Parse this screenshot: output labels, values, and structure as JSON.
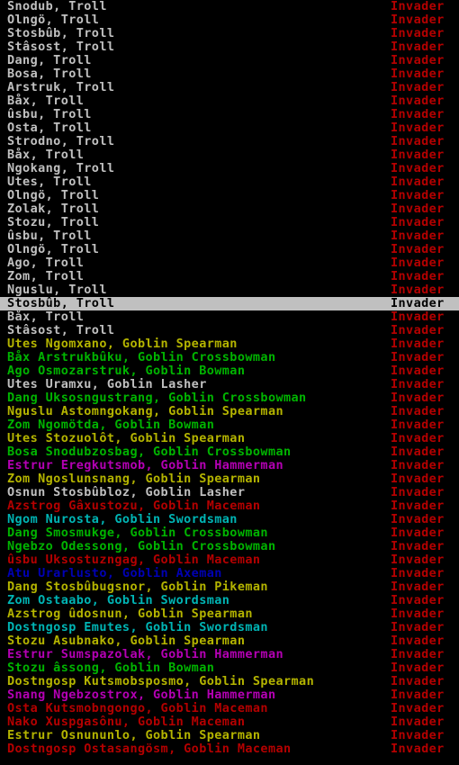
{
  "status_color": "#b40000",
  "selected_index": 22,
  "units": [
    {
      "name": "Snodub, Troll",
      "status": "Invader",
      "color": "#c0c0c0"
    },
    {
      "name": "Olngö, Troll",
      "status": "Invader",
      "color": "#c0c0c0"
    },
    {
      "name": "Stosbûb, Troll",
      "status": "Invader",
      "color": "#c0c0c0"
    },
    {
      "name": "Stâsost, Troll",
      "status": "Invader",
      "color": "#c0c0c0"
    },
    {
      "name": "Dang, Troll",
      "status": "Invader",
      "color": "#c0c0c0"
    },
    {
      "name": "Bosa, Troll",
      "status": "Invader",
      "color": "#c0c0c0"
    },
    {
      "name": "Arstruk, Troll",
      "status": "Invader",
      "color": "#c0c0c0"
    },
    {
      "name": "Båx, Troll",
      "status": "Invader",
      "color": "#c0c0c0"
    },
    {
      "name": "ûsbu, Troll",
      "status": "Invader",
      "color": "#c0c0c0"
    },
    {
      "name": "Osta, Troll",
      "status": "Invader",
      "color": "#c0c0c0"
    },
    {
      "name": "Strodno, Troll",
      "status": "Invader",
      "color": "#c0c0c0"
    },
    {
      "name": "Båx, Troll",
      "status": "Invader",
      "color": "#c0c0c0"
    },
    {
      "name": "Ngokang, Troll",
      "status": "Invader",
      "color": "#c0c0c0"
    },
    {
      "name": "Utes, Troll",
      "status": "Invader",
      "color": "#c0c0c0"
    },
    {
      "name": "Olngö, Troll",
      "status": "Invader",
      "color": "#c0c0c0"
    },
    {
      "name": "Zolak, Troll",
      "status": "Invader",
      "color": "#c0c0c0"
    },
    {
      "name": "Stozu, Troll",
      "status": "Invader",
      "color": "#c0c0c0"
    },
    {
      "name": "ûsbu, Troll",
      "status": "Invader",
      "color": "#c0c0c0"
    },
    {
      "name": "Olngö, Troll",
      "status": "Invader",
      "color": "#c0c0c0"
    },
    {
      "name": "Ago, Troll",
      "status": "Invader",
      "color": "#c0c0c0"
    },
    {
      "name": "Zom, Troll",
      "status": "Invader",
      "color": "#c0c0c0"
    },
    {
      "name": "Nguslu, Troll",
      "status": "Invader",
      "color": "#c0c0c0"
    },
    {
      "name": "Stosbûb, Troll",
      "status": "Invader",
      "color": "#c0c0c0"
    },
    {
      "name": "Båx, Troll",
      "status": "Invader",
      "color": "#c0c0c0"
    },
    {
      "name": "Stâsost, Troll",
      "status": "Invader",
      "color": "#c0c0c0"
    },
    {
      "name": "Utes Ngomxano, Goblin Spearman",
      "status": "Invader",
      "color": "#b4b400"
    },
    {
      "name": "Båx Arstrukbûku, Goblin Crossbowman",
      "status": "Invader",
      "color": "#00b400"
    },
    {
      "name": "Ago Osmozarstruk, Goblin Bowman",
      "status": "Invader",
      "color": "#00b400"
    },
    {
      "name": "Utes Uramxu, Goblin Lasher",
      "status": "Invader",
      "color": "#c0c0c0"
    },
    {
      "name": "Dang Uksosngustrang, Goblin Crossbowman",
      "status": "Invader",
      "color": "#00b400"
    },
    {
      "name": "Nguslu Astomngokang, Goblin Spearman",
      "status": "Invader",
      "color": "#b4b400"
    },
    {
      "name": "Zom Ngomötda, Goblin Bowman",
      "status": "Invader",
      "color": "#00b400"
    },
    {
      "name": "Utes Stozuolôt, Goblin Spearman",
      "status": "Invader",
      "color": "#b4b400"
    },
    {
      "name": "Bosa Snodubzosbag, Goblin Crossbowman",
      "status": "Invader",
      "color": "#00b400"
    },
    {
      "name": "Estrur Eregkutsmob, Goblin Hammerman",
      "status": "Invader",
      "color": "#b400b4"
    },
    {
      "name": "Zom Ngoslunsnang, Goblin Spearman",
      "status": "Invader",
      "color": "#b4b400"
    },
    {
      "name": "Osnun Stosbûbloz, Goblin Lasher",
      "status": "Invader",
      "color": "#c0c0c0"
    },
    {
      "name": "Azstrog Gâxustozu, Goblin Maceman",
      "status": "Invader",
      "color": "#b40000"
    },
    {
      "name": "Ngom Nurosta, Goblin Swordsman",
      "status": "Invader",
      "color": "#00b4b4"
    },
    {
      "name": "Dang Smosmukge, Goblin Crossbowman",
      "status": "Invader",
      "color": "#00b400"
    },
    {
      "name": "Ngebzo Odessong, Goblin Crossbowman",
      "status": "Invader",
      "color": "#00b400"
    },
    {
      "name": "ûsbu Uksostuzngag, Goblin Maceman",
      "status": "Invader",
      "color": "#b40000"
    },
    {
      "name": "Atu Urarlusto, Goblin Axeman",
      "status": "Invader",
      "color": "#0000b4"
    },
    {
      "name": "Dang Stosbûbugsnor, Goblin Pikeman",
      "status": "Invader",
      "color": "#b4b400"
    },
    {
      "name": "Zom Ostaabo, Goblin Swordsman",
      "status": "Invader",
      "color": "#00b4b4"
    },
    {
      "name": "Azstrog ûdosnun, Goblin Spearman",
      "status": "Invader",
      "color": "#b4b400"
    },
    {
      "name": "Dostngosp Emutes, Goblin Swordsman",
      "status": "Invader",
      "color": "#00b4b4"
    },
    {
      "name": "Stozu Asubnako, Goblin Spearman",
      "status": "Invader",
      "color": "#b4b400"
    },
    {
      "name": "Estrur Sumspazolak, Goblin Hammerman",
      "status": "Invader",
      "color": "#b400b4"
    },
    {
      "name": "Stozu âssong, Goblin Bowman",
      "status": "Invader",
      "color": "#00b400"
    },
    {
      "name": "Dostngosp Kutsmobsposmo, Goblin Spearman",
      "status": "Invader",
      "color": "#b4b400"
    },
    {
      "name": "Snang Ngebzostrox, Goblin Hammerman",
      "status": "Invader",
      "color": "#b400b4"
    },
    {
      "name": "Osta Kutsmobngongo, Goblin Maceman",
      "status": "Invader",
      "color": "#b40000"
    },
    {
      "name": "Nako Xuspgasônu, Goblin Maceman",
      "status": "Invader",
      "color": "#b40000"
    },
    {
      "name": "Estrur Osnununlo, Goblin Spearman",
      "status": "Invader",
      "color": "#b4b400"
    },
    {
      "name": "Dostngosp Ostasangösm, Goblin Maceman",
      "status": "Invader",
      "color": "#b40000"
    }
  ]
}
